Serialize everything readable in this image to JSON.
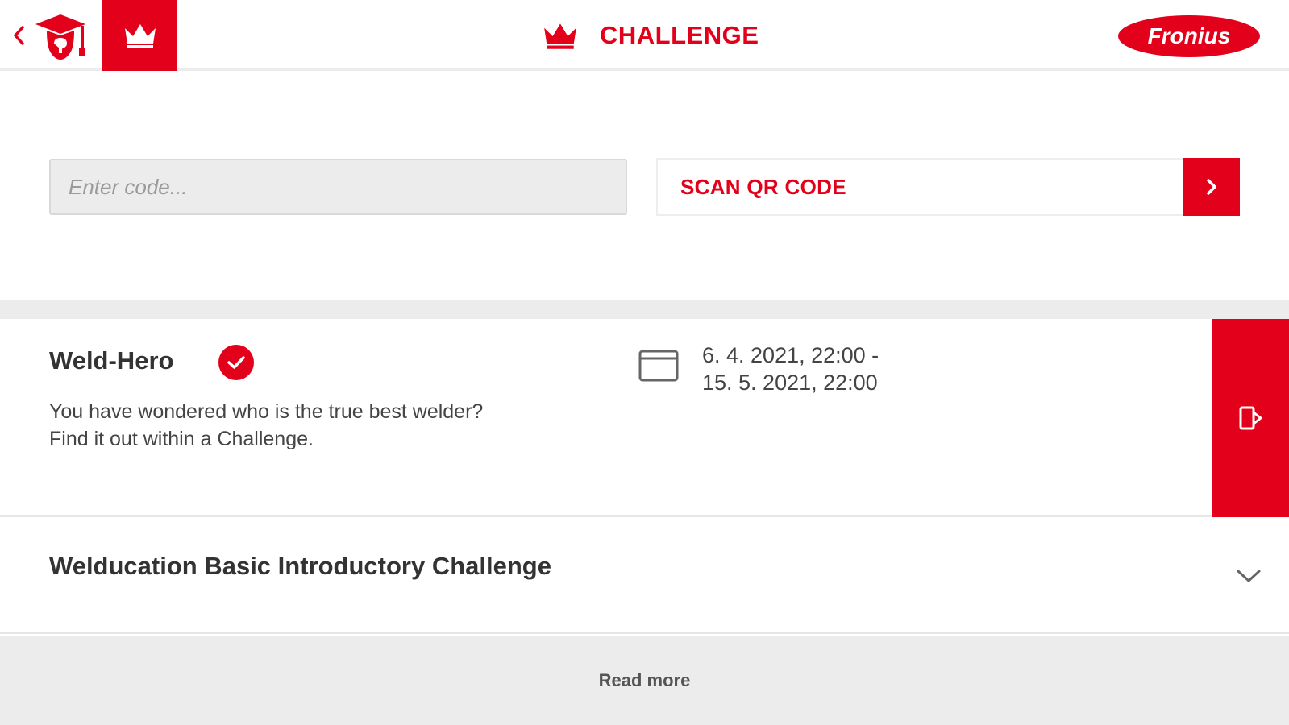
{
  "header": {
    "title": "CHALLENGE",
    "back_icon": "chevron-left-icon",
    "academy_icon": "graduate-cap-icon",
    "tab_icon": "crown-icon",
    "title_icon": "crown-icon",
    "brand_logo_text": "Fronius"
  },
  "code_entry": {
    "placeholder": "Enter code...",
    "value": "",
    "scan_label": "SCAN QR CODE",
    "scan_icon": "chevron-right-icon"
  },
  "challenge": {
    "title": "Weld-Hero",
    "status_icon": "checkmark-circle-icon",
    "description_line1": "You have wondered who is the true best welder?",
    "description_line2": "Find it out within a Challenge.",
    "date_icon": "calendar-icon",
    "date_line1": "6. 4. 2021, 22:00 -",
    "date_line2": "15. 5. 2021, 22:00",
    "action_icon": "enter-door-icon"
  },
  "accordion": {
    "title": "Welducation Basic Introductory Challenge",
    "icon": "chevron-down-icon"
  },
  "footer": {
    "read_more_label": "Read more"
  },
  "colors": {
    "brand_red": "#e2001a",
    "band_gray": "#ececec",
    "text_dark": "#333333"
  }
}
